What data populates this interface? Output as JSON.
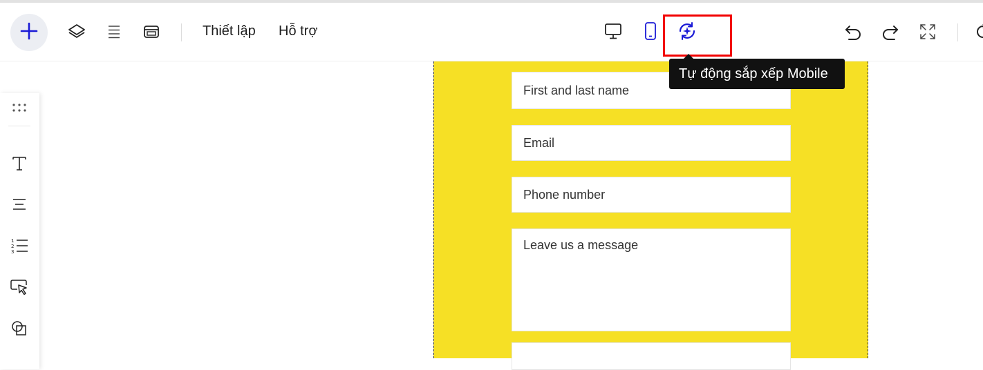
{
  "toolbar": {
    "menu_settings": "Thiết lập",
    "menu_support": "Hỗ trợ",
    "icons": {
      "add": "plus-icon",
      "layers": "layers-icon",
      "sections": "sections-icon",
      "popup": "window-icon",
      "desktop": "desktop-icon",
      "mobile": "mobile-icon",
      "auto_arrange": "auto-arrange-mobile-icon",
      "undo": "undo-icon",
      "redo": "redo-icon",
      "fullscreen": "fullscreen-icon",
      "refresh": "refresh-icon"
    },
    "active_device": "mobile",
    "accent_color": "#1a1ad6"
  },
  "tooltip": {
    "text": "Tự động sắp xếp Mobile"
  },
  "form": {
    "background_color": "#f6e025",
    "name_placeholder": "First and last name",
    "email_placeholder": "Email",
    "phone_placeholder": "Phone number",
    "message_placeholder": "Leave us a message"
  },
  "left_panel": {
    "tools": [
      "drag-handle-icon",
      "text-icon",
      "paragraph-icon",
      "numbered-list-icon",
      "button-icon",
      "shape-icon"
    ]
  }
}
